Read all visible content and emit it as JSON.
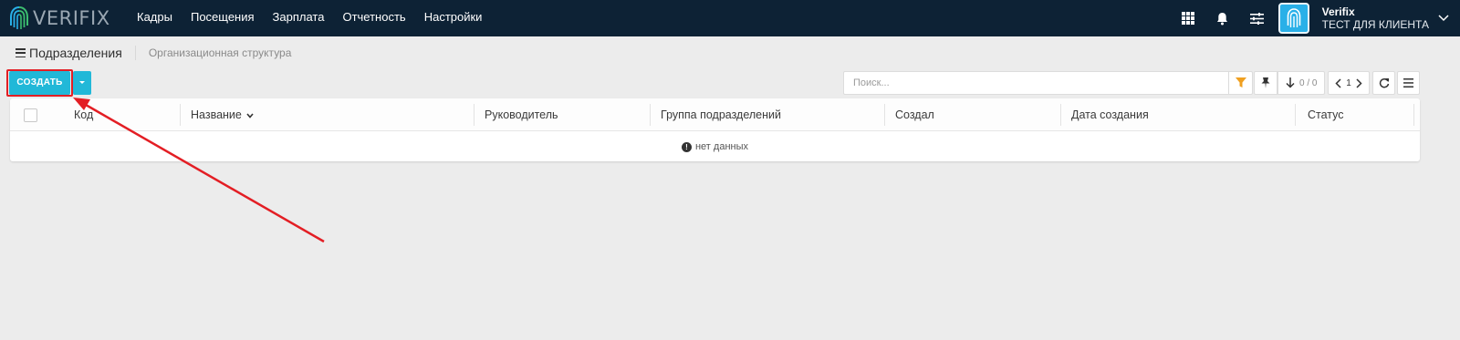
{
  "app": {
    "logo_text": "VERIFIX"
  },
  "navbar": {
    "menu": [
      {
        "label": "Кадры"
      },
      {
        "label": "Посещения"
      },
      {
        "label": "Зарплата"
      },
      {
        "label": "Отчетность"
      },
      {
        "label": "Настройки"
      }
    ],
    "icons": [
      "apps-grid-icon",
      "bell-icon",
      "sliders-icon"
    ],
    "user": {
      "name": "Verifix",
      "company": "ТЕСТ ДЛЯ КЛИЕНТА"
    }
  },
  "breadcrumb": {
    "active": "Подразделения",
    "item": "Организационная структура"
  },
  "toolbar": {
    "create_label": "СОЗДАТЬ",
    "search_placeholder": "Поиск...",
    "counter": "0 / 0",
    "page": "1"
  },
  "table": {
    "columns": [
      {
        "label": "Код"
      },
      {
        "label": "Название"
      },
      {
        "label": "Руководитель"
      },
      {
        "label": "Группа подразделений"
      },
      {
        "label": "Создал"
      },
      {
        "label": "Дата создания"
      },
      {
        "label": "Статус"
      }
    ],
    "empty_text": "нет данных"
  },
  "colors": {
    "navbar": "#0d2235",
    "accent": "#21b8d8",
    "annotation": "#e31e24",
    "filter": "#f0a020"
  }
}
